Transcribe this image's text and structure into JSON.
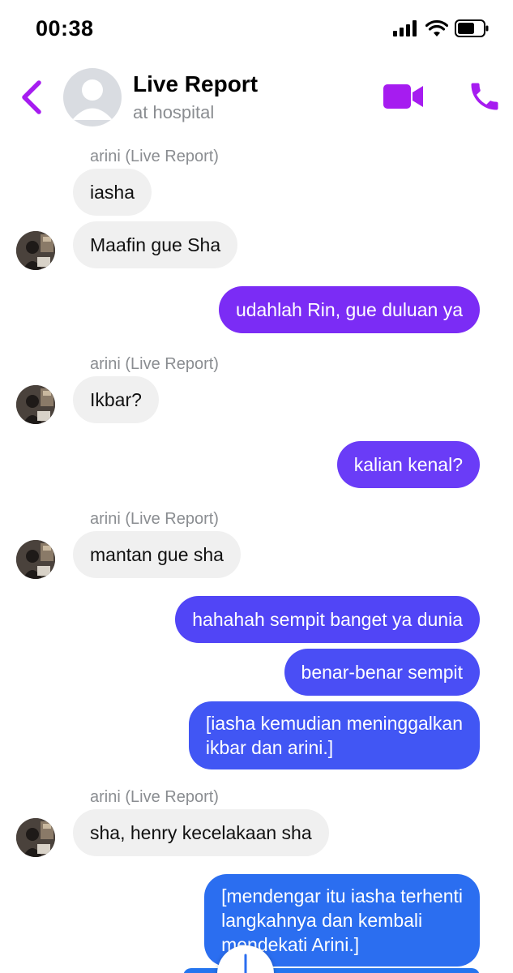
{
  "status": {
    "time": "00:38"
  },
  "header": {
    "title": "Live Report",
    "subtitle": "at hospital"
  },
  "colors": {
    "accent": "#a61cf0",
    "incoming_bubble": "#f0f0f0",
    "out_gradient": [
      "#7b2cf5",
      "#6a3cf7",
      "#4a4ef5",
      "#3b5ef2",
      "#2b6ef0"
    ]
  },
  "icons": {
    "back": "chevron-left-icon",
    "video": "video-camera-icon",
    "call": "phone-icon",
    "scroll": "arrow-down-icon"
  },
  "messages": [
    {
      "sender": "arini (Live Report)",
      "text": "iasha"
    },
    {
      "text": "Maafin gue Sha"
    },
    {
      "text": "udahlah Rin, gue duluan ya"
    },
    {
      "sender": "arini (Live Report)",
      "text": "Ikbar?"
    },
    {
      "text": "kalian kenal?"
    },
    {
      "sender": "arini (Live Report)",
      "text": "mantan gue sha"
    },
    {
      "text": "hahahah sempit banget ya dunia"
    },
    {
      "text": "benar-benar sempit"
    },
    {
      "lines": [
        "[iasha kemudian meninggalkan",
        "ikbar dan arini.]"
      ]
    },
    {
      "sender": "arini (Live Report)",
      "text": "sha, henry kecelakaan sha"
    },
    {
      "lines": [
        "[mendengar itu iasha terhenti",
        "langkahnya dan kembali",
        "mendekati Arini.]"
      ]
    }
  ]
}
